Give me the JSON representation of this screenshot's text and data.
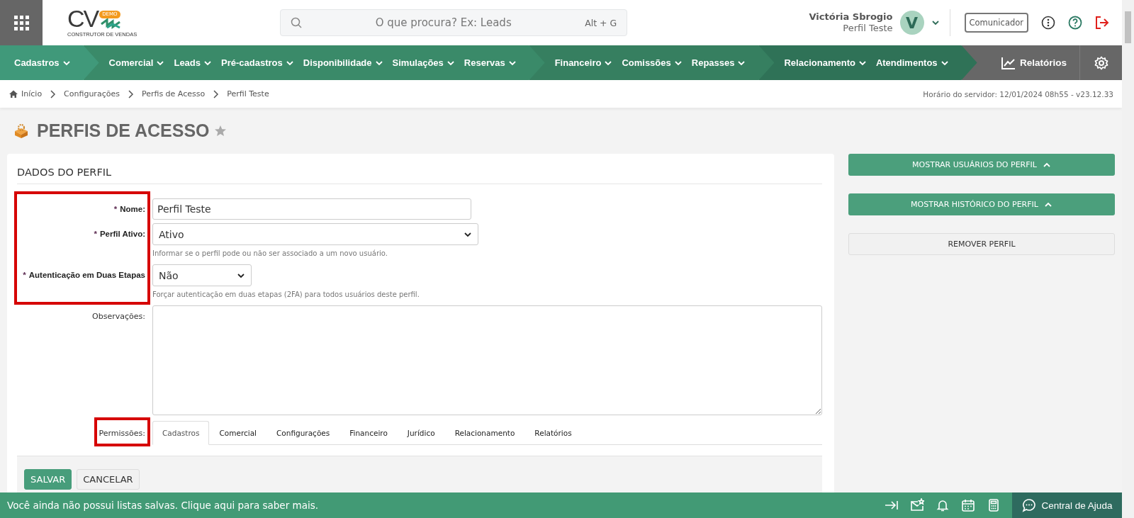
{
  "header": {
    "logo": {
      "letters": "CV",
      "badge": "DEMO",
      "tagline": "CONSTRUTOR DE VENDAS"
    },
    "search": {
      "placeholder": "O que procura? Ex: Leads",
      "shortcut": "Alt + G"
    },
    "user": {
      "name": "Victória Sbrogio",
      "profile": "Perfil Teste",
      "initial": "V"
    },
    "communicator": "Comunicador"
  },
  "nav": {
    "groups": [
      {
        "color": "#40997a",
        "items": [
          {
            "label": "Cadastros"
          }
        ]
      },
      {
        "color": "#3a8a69",
        "items": [
          {
            "label": "Comercial"
          },
          {
            "label": "Leads"
          },
          {
            "label": "Pré-cadastros"
          },
          {
            "label": "Disponibilidade"
          },
          {
            "label": "Simulações"
          },
          {
            "label": "Reservas"
          }
        ]
      },
      {
        "color": "#367f60",
        "items": [
          {
            "label": "Financeiro"
          },
          {
            "label": "Comissões"
          },
          {
            "label": "Repasses"
          }
        ]
      },
      {
        "color": "#2f7257",
        "items": [
          {
            "label": "Relacionamento"
          },
          {
            "label": "Atendimentos"
          }
        ]
      }
    ],
    "reports": "Relatórios"
  },
  "breadcrumb": {
    "items": [
      "Início",
      "Configurações",
      "Perfis de Acesso",
      "Perfil Teste"
    ],
    "server_time": "Horário do servidor: 12/01/2024 08h55 - v23.12.33"
  },
  "page_title": "PERFIS DE ACESSO",
  "form": {
    "title": "DADOS DO PERFIL",
    "fields": [
      {
        "kind": "text",
        "required_mark": "*",
        "label": "Nome:",
        "highlighted": true,
        "value": "Perfil Teste"
      },
      {
        "kind": "select",
        "required_mark": "*",
        "label": "Perfil Ativo:",
        "highlighted": true,
        "value": "Ativo",
        "hint": "Informar se o perfil pode ou não ser associado a um novo usuário."
      },
      {
        "kind": "choice",
        "required_mark": "*",
        "label": "Autenticação em Duas Etapas",
        "highlighted": true,
        "value": "Não",
        "hint": "Forçar autenticação em duas etapas (2FA) para todos usuários deste perfil."
      },
      {
        "kind": "textarea",
        "label": "Observações:",
        "highlighted": false
      },
      {
        "kind": "tabs",
        "label": "Permissões:",
        "highlighted": true,
        "tabs": [
          {
            "label": "Cadastros",
            "selected": true
          },
          {
            "label": "Comercial",
            "selected": false
          },
          {
            "label": "Configurações",
            "selected": false
          },
          {
            "label": "Financeiro",
            "selected": false
          },
          {
            "label": "Jurídico",
            "selected": false
          },
          {
            "label": "Relacionamento",
            "selected": false
          },
          {
            "label": "Relatórios",
            "selected": false
          }
        ]
      }
    ],
    "actions": [
      {
        "label": "SALVAR",
        "kind": "primary"
      },
      {
        "label": "CANCELAR",
        "kind": "secondary"
      }
    ]
  },
  "side_buttons": [
    {
      "label": "MOSTRAR USUÁRIOS DO PERFIL",
      "kind": "toggle"
    },
    {
      "label": "MOSTRAR HISTÓRICO DO PERFIL",
      "kind": "toggle"
    },
    {
      "label": "REMOVER PERFIL",
      "kind": "plain"
    }
  ],
  "footer": {
    "message": "Você ainda não possui listas salvas. Clique aqui para saber mais.",
    "help": "Central de Ajuda"
  }
}
